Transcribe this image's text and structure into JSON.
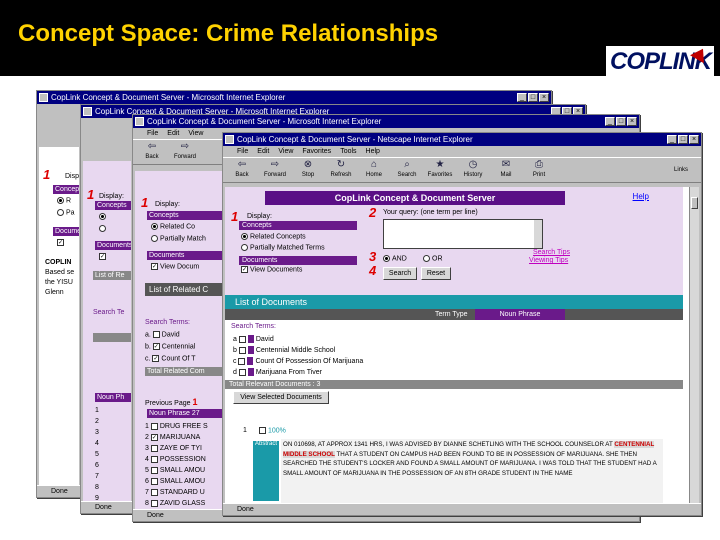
{
  "slide": {
    "title": "Concept Space: Crime Relationships"
  },
  "logo": {
    "text": "COPLINK"
  },
  "window": {
    "title": "CopLink Concept & Document Server - Netscape Internet Explorer",
    "title_short": "CopLink Concept & Document Server - Microsoft Internet Explorer",
    "menu": [
      "File",
      "Edit",
      "View",
      "Favorites",
      "Tools",
      "Help"
    ],
    "toolbar": [
      "Back",
      "Forward",
      "Stop",
      "Refresh",
      "Home",
      "Search",
      "Favorites",
      "History",
      "Mail",
      "Print"
    ],
    "links_label": "Links",
    "status": "Done"
  },
  "page": {
    "banner": "CopLink Concept & Document Server",
    "help": "Help",
    "display_label": "Display:",
    "concepts_header": "Concepts",
    "related_concepts": "Related Concepts",
    "partially_matched": "Partially Matched Terms",
    "documents_header": "Documents",
    "view_documents": "View Documents",
    "query_label": "Your query: (one term per line)",
    "and_label": "AND",
    "or_label": "OR",
    "search_button": "Search",
    "reset_button": "Reset",
    "search_tips": "Search Tips",
    "viewing_tips": "Viewing Tips",
    "step_numbers": [
      "1",
      "2",
      "3",
      "4"
    ],
    "list_title": "List of Documents",
    "col_term_type": "Term Type",
    "col_noun_phrase": "Noun Phrase",
    "search_terms_label": "Search Terms:",
    "terms": [
      {
        "letter": "a",
        "text": "David"
      },
      {
        "letter": "b",
        "text": "Centennial Middle School"
      },
      {
        "letter": "c",
        "text": "Count Of Possession Of Marijuana"
      },
      {
        "letter": "d",
        "text": "Marijuana From Tiver"
      }
    ],
    "total_relevant": "Total Relevant Documents : 3",
    "view_selected": "View Selected Documents",
    "result_index": "1",
    "result_score": "100%",
    "abstract_label": "Abstract",
    "abstract_pre": "ON 010698, AT APPROX 1341 HRS, I WAS ADVISED BY DIANNE SCHETLING WITH THE SCHOOL COUNSELOR AT",
    "abstract_hl": "CENTENNIAL MIDDLE SCHOOL",
    "abstract_post": "THAT A STUDENT ON CAMPUS HAD BEEN FOUND TO BE IN POSSESSION OF MARIJUANA. SHE THEN SEARCHED THE STUDENT'S LOCKER AND FOUND A SMALL AMOUNT OF MARIJUANA. I WAS TOLD THAT THE STUDENT HAD A SMALL AMOUNT OF MARIJUANA IN THE POSSESSION OF AN 8TH GRADE STUDENT IN THE NAME"
  },
  "back_window_2": {
    "display_label": "Display:",
    "concepts_header": "Concepts",
    "related_concepts": "Related Co",
    "partially_match": "Partially Match",
    "documents_header": "Documents",
    "view_documents": "View Docum",
    "list_title": "List of Related C",
    "search_terms_label": "Search Terms:",
    "terms": [
      {
        "letter": "a",
        "text": "David"
      },
      {
        "letter": "b",
        "text": "Centennial"
      },
      {
        "letter": "c",
        "text": "Count Of T"
      }
    ],
    "total_related": "Total Related Com",
    "previous_page": "Previous Page",
    "page_num": "1",
    "noun_phrase": "Noun Phrase",
    "count": "27",
    "rows": [
      {
        "n": "1",
        "text": "DRUG FREE S"
      },
      {
        "n": "2",
        "text": "MARIJUANA"
      },
      {
        "n": "3",
        "text": "ZAYE OF TYI"
      },
      {
        "n": "4",
        "text": "POSSESSION"
      },
      {
        "n": "5",
        "text": "SMALL AMOU"
      },
      {
        "n": "6",
        "text": "SMALL AMOU"
      },
      {
        "n": "7",
        "text": "STANDARD U"
      },
      {
        "n": "8",
        "text": "ZAVID GLASS"
      }
    ]
  },
  "back_window_3": {
    "display_label": "Display:",
    "concepts_header": "Concepts",
    "documents_header": "Documents",
    "list_title": "List of Re",
    "search_terms_label": "Search Te",
    "noun_phrase": "Noun Ph",
    "rows": [
      "1",
      "2",
      "3",
      "4",
      "5",
      "6",
      "7",
      "8",
      "9"
    ]
  },
  "back_window_4": {
    "brand": "COPLIN",
    "text_lines": [
      "Based se",
      "the YISU",
      "Glenn"
    ],
    "concepts_header": "Concepts",
    "documents_header": "Docume"
  },
  "colors": {
    "title": "#ffd200",
    "banner": "#5a0f86",
    "teal": "#1a9aa8",
    "highlight": "#c00000"
  }
}
